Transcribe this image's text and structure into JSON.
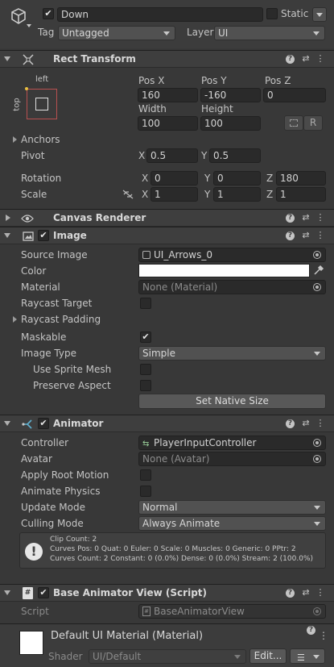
{
  "gameobject": {
    "name": "Down",
    "static_label": "Static",
    "tag_label": "Tag",
    "tag_value": "Untagged",
    "layer_label": "Layer",
    "layer_value": "UI"
  },
  "rect_transform": {
    "title": "Rect Transform",
    "anchor_h": "left",
    "anchor_v": "top",
    "pos_x_label": "Pos X",
    "pos_y_label": "Pos Y",
    "pos_z_label": "Pos Z",
    "pos_x": "160",
    "pos_y": "-160",
    "pos_z": "0",
    "width_label": "Width",
    "height_label": "Height",
    "width": "100",
    "height": "100",
    "r_button": "R",
    "anchors_label": "Anchors",
    "pivot_label": "Pivot",
    "pivot_x": "0.5",
    "pivot_y": "0.5",
    "rotation_label": "Rotation",
    "rot_x": "0",
    "rot_y": "0",
    "rot_z": "180",
    "scale_label": "Scale",
    "scale_x": "1",
    "scale_y": "1",
    "scale_z": "1",
    "x": "X",
    "y": "Y",
    "z": "Z"
  },
  "canvas_renderer": {
    "title": "Canvas Renderer"
  },
  "image": {
    "title": "Image",
    "source_image_label": "Source Image",
    "source_image": "UI_Arrows_0",
    "color_label": "Color",
    "color_value": "#ffffff",
    "material_label": "Material",
    "material": "None (Material)",
    "raycast_target_label": "Raycast Target",
    "raycast_padding_label": "Raycast Padding",
    "maskable_label": "Maskable",
    "image_type_label": "Image Type",
    "image_type": "Simple",
    "use_sprite_mesh_label": "Use Sprite Mesh",
    "preserve_aspect_label": "Preserve Aspect",
    "set_native_size": "Set Native Size"
  },
  "animator": {
    "title": "Animator",
    "controller_label": "Controller",
    "controller": "PlayerInputController",
    "avatar_label": "Avatar",
    "avatar": "None (Avatar)",
    "apply_root_motion_label": "Apply Root Motion",
    "animate_physics_label": "Animate Physics",
    "update_mode_label": "Update Mode",
    "update_mode": "Normal",
    "culling_mode_label": "Culling Mode",
    "culling_mode": "Always Animate",
    "info_line1": "Clip Count: 2",
    "info_line2": "Curves Pos: 0 Quat: 0 Euler: 0 Scale: 0 Muscles: 0 Generic: 0 PPtr: 2",
    "info_line3": "Curves Count: 2 Constant: 0 (0.0%) Dense: 0 (0.0%) Stream: 2 (100.0%)"
  },
  "base_animator_view": {
    "title": "Base Animator View (Script)",
    "script_label": "Script",
    "script": "BaseAnimatorView"
  },
  "material": {
    "title": "Default UI Material (Material)",
    "shader_label": "Shader",
    "shader": "UI/Default",
    "edit_button": "Edit..."
  },
  "colors": {
    "panel_bg": "#383838",
    "header_bg": "#3e3e3e",
    "field_bg": "#2a2a2a",
    "accent_red": "#d04848"
  }
}
